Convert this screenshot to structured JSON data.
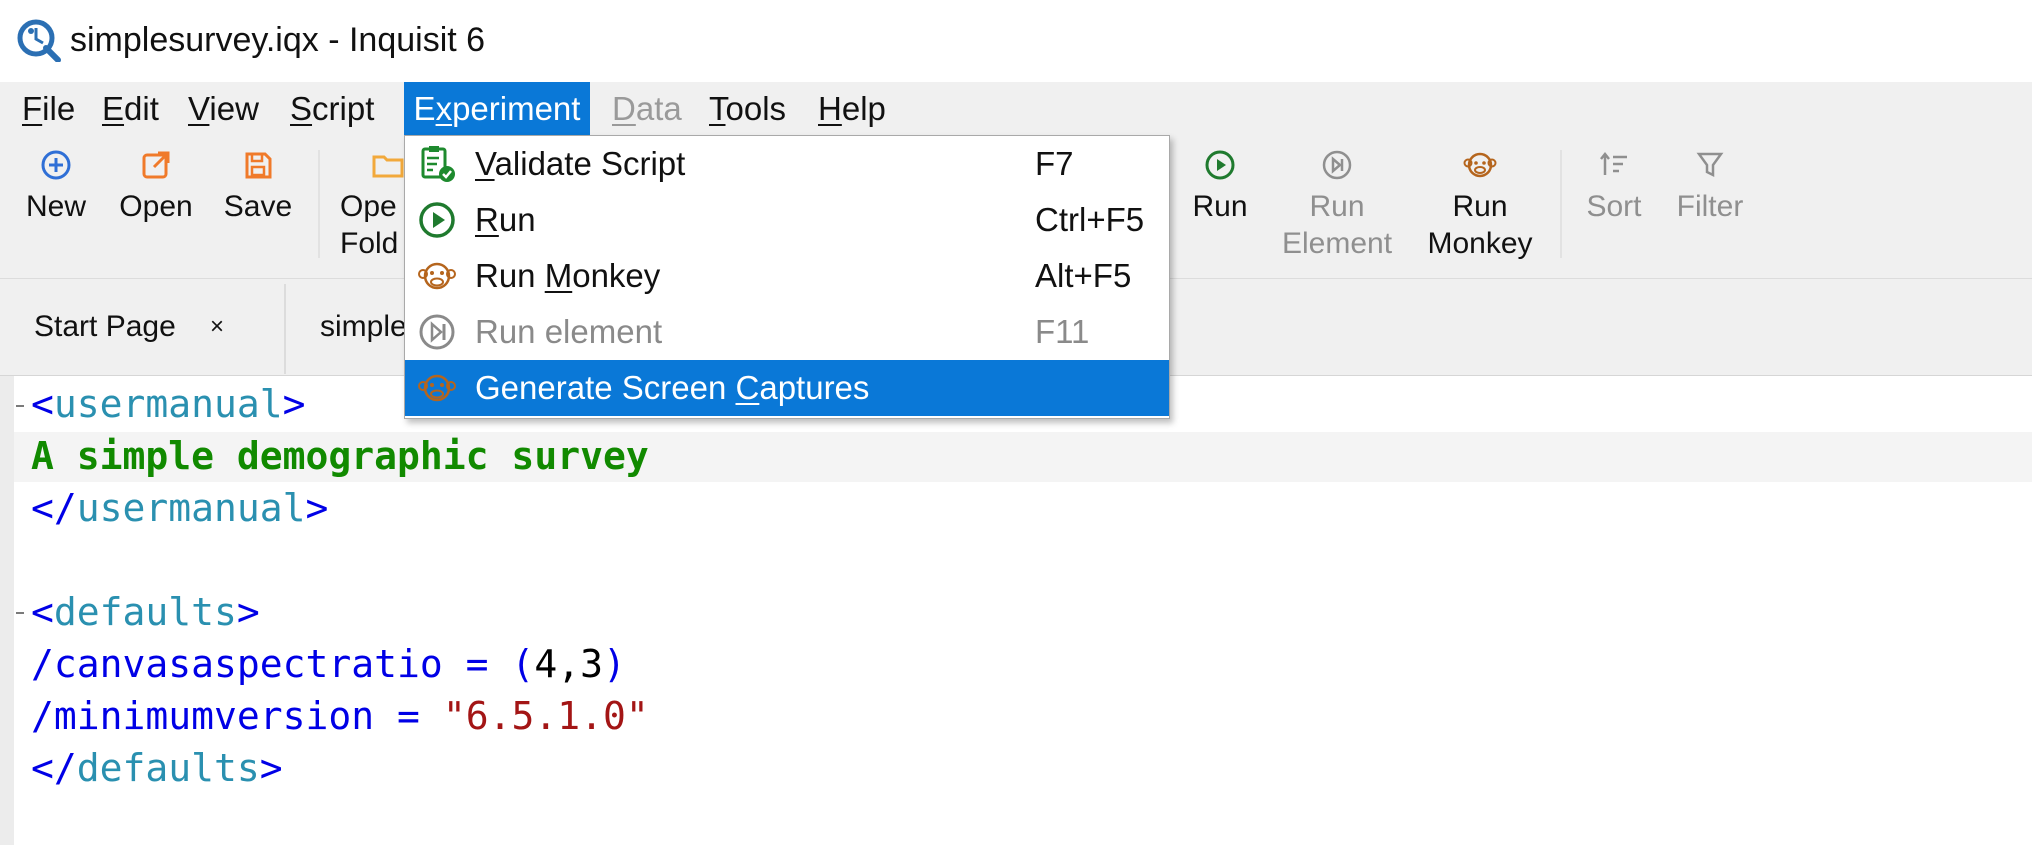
{
  "window": {
    "title": "simplesurvey.iqx - Inquisit 6"
  },
  "menubar": {
    "items": [
      {
        "label": "File",
        "ul": "F",
        "rest": "ile"
      },
      {
        "label": "Edit",
        "ul": "E",
        "rest": "dit"
      },
      {
        "label": "View",
        "ul": "V",
        "rest": "iew"
      },
      {
        "label": "Script",
        "ul": "S",
        "rest": "cript"
      },
      {
        "label": "Experiment",
        "pre": "E",
        "ul": "x",
        "rest": "periment"
      },
      {
        "label": "Data",
        "ul": "D",
        "rest": "ata"
      },
      {
        "label": "Tools",
        "ul": "T",
        "rest": "ools"
      },
      {
        "label": "Help",
        "ul": "H",
        "rest": "elp"
      }
    ]
  },
  "toolbar": {
    "new": "New",
    "open": "Open",
    "save": "Save",
    "open_folder_1": "Ope",
    "open_folder_2": "Fold",
    "run": "Run",
    "run_element_1": "Run",
    "run_element_2": "Element",
    "run_monkey_1": "Run",
    "run_monkey_2": "Monkey",
    "sort": "Sort",
    "filter": "Filter"
  },
  "tabs": {
    "start_page": "Start Page",
    "close_glyph": "×",
    "script_tab": "simple"
  },
  "dropdown": {
    "items": [
      {
        "pre": "",
        "ul": "V",
        "rest": "alidate Script",
        "shortcut": "F7"
      },
      {
        "pre": "",
        "ul": "R",
        "rest": "un",
        "shortcut": "Ctrl+F5"
      },
      {
        "pre": "Run ",
        "ul": "M",
        "rest": "onkey",
        "shortcut": "Alt+F5"
      },
      {
        "pre": "Run element",
        "ul": "",
        "rest": "",
        "shortcut": "F11"
      },
      {
        "pre": "Generate Screen ",
        "ul": "C",
        "rest": "aptures",
        "shortcut": ""
      }
    ]
  },
  "code": {
    "l1_open": "<",
    "l1_name": "usermanual",
    "l1_close": ">",
    "l2_text": "A simple demographic survey",
    "l3_open": "</",
    "l3_name": "usermanual",
    "l3_close": ">",
    "l5_open": "<",
    "l5_name": "defaults",
    "l5_close": ">",
    "l6_attr": "/canvasaspectratio = (",
    "l6_num": "4,3",
    "l6_end": ")",
    "l7_attr": "/minimumversion = ",
    "l7_str": "\"6.5.1.0\"",
    "l8_open": "</",
    "l8_name": "defaults",
    "l8_close": ">"
  },
  "colors": {
    "accent": "#0a78d7",
    "toolbar_bg": "#f0f0f0",
    "tag": "#0000e6",
    "tag_name": "#2a90b0",
    "text": "#118a00",
    "string": "#a31515"
  }
}
